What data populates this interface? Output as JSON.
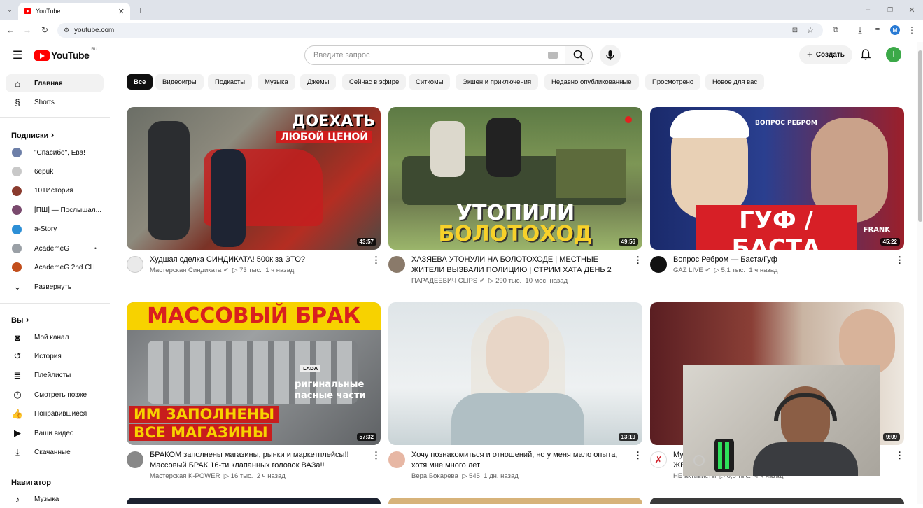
{
  "browser": {
    "tab_title": "YouTube",
    "url": "youtube.com",
    "profile_initial": "M"
  },
  "header": {
    "logo": "YouTube",
    "region": "RU",
    "search_placeholder": "Введите запрос",
    "create_label": "Создать",
    "user_initial": "i"
  },
  "sidebar": {
    "main": [
      {
        "label": "Главная",
        "icon": "home-icon",
        "active": true
      },
      {
        "label": "Shorts",
        "icon": "shorts-icon"
      }
    ],
    "subscriptions_title": "Подписки",
    "subscriptions": [
      {
        "label": "\"Спасибо\", Ева!",
        "color": "#6d7fa8"
      },
      {
        "label": "6epuk",
        "color": "#c8c8c8"
      },
      {
        "label": "101История",
        "color": "#8a3b2e"
      },
      {
        "label": "[ПШ] — Послышал...",
        "color": "#7a4a6e"
      },
      {
        "label": "a-Story",
        "color": "#2c8fd6"
      },
      {
        "label": "AcademeG",
        "color": "#9aa0a6",
        "dot": "•"
      },
      {
        "label": "AcademeG 2nd CH",
        "color": "#c24e1c"
      }
    ],
    "expand_label": "Развернуть",
    "you_title": "Вы",
    "you": [
      {
        "label": "Мой канал",
        "icon": "channel-icon"
      },
      {
        "label": "История",
        "icon": "history-icon"
      },
      {
        "label": "Плейлисты",
        "icon": "playlists-icon"
      },
      {
        "label": "Смотреть позже",
        "icon": "watch-later-icon"
      },
      {
        "label": "Понравившиеся",
        "icon": "like-icon"
      },
      {
        "label": "Ваши видео",
        "icon": "your-videos-icon"
      },
      {
        "label": "Скачанные",
        "icon": "download-icon"
      }
    ],
    "navigator_title": "Навигатор",
    "navigator": [
      {
        "label": "Музыка",
        "icon": "music-icon"
      }
    ]
  },
  "chips": [
    "Все",
    "Видеоигры",
    "Подкасты",
    "Музыка",
    "Джемы",
    "Сейчас в эфире",
    "Ситкомы",
    "Экшен и приключения",
    "Недавно опубликованные",
    "Просмотрено",
    "Новое для вас"
  ],
  "videos": [
    {
      "title": "Худшая сделка СИНДИКАТА! 500к за ЭТО?",
      "channel": "Мастерская Синдиката",
      "verified": true,
      "views": "73 тыс.",
      "age": "1 ч назад",
      "duration": "43:57",
      "overlay": [
        "ДОЕХАТЬ",
        "любой ценой"
      ]
    },
    {
      "title": "ХАЗЯЕВА УТОНУЛИ НА БОЛОТОХОДЕ | МЕСТНЫЕ ЖИТЕЛИ ВЫЗВАЛИ ПОЛИЦИЮ | СТРИМ ХАТА ДЕНЬ 2",
      "channel": "ПАРАДЕЕВИЧ CLIPS",
      "verified": true,
      "views": "290 тыс.",
      "age": "10 мес. назад",
      "duration": "49:56",
      "overlay": [
        "УТОПИЛИ",
        "БОЛОТОХОД"
      ]
    },
    {
      "title": "Вопрос Ребром — Баста/Гуф",
      "channel": "GAZ LIVE",
      "verified": true,
      "views": "5,1 тыс.",
      "age": "1 ч назад",
      "duration": "45:22",
      "overlay": [
        "ГУФ / БАСТА",
        "ВОПРОС РЕБРОМ",
        "FRANK"
      ]
    },
    {
      "title": "БРАКОМ заполнены магазины, рынки и маркетплейсы!! Массовый БРАК 16-ти клапанных головок ВАЗа!!",
      "channel": "Мастерская K-POWER",
      "verified": false,
      "views": "16 тыс.",
      "age": "2 ч назад",
      "duration": "57:32",
      "overlay": [
        "МАССОВЫЙ БРАК",
        "ИМ ЗАПОЛНЕНЫ",
        "ВСЕ МАГАЗИНЫ",
        "LADA",
        "ригинальные",
        "пасные части"
      ]
    },
    {
      "title": "Хочу познакомиться и отношений, но у меня мало опыта, хотя мне много лет",
      "channel": "Вера Бокарева",
      "verified": false,
      "views": "545",
      "age": "1 дн. назад",
      "duration": "13:19",
      "overlay": []
    },
    {
      "title": "Му",
      "title2": "ЖЕ",
      "channel": "НЕ активисты",
      "verified": false,
      "views": "6,8 тыс.",
      "age": "4 ч назад",
      "duration": "9:09",
      "overlay": []
    }
  ],
  "colors": {
    "brand": "#ff0000",
    "chip_active": "#0f0f0f",
    "chip": "#f2f2f2",
    "meta": "#606060"
  }
}
